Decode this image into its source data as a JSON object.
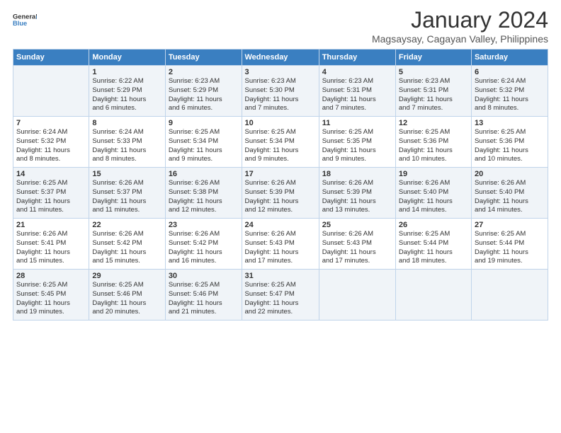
{
  "logo": {
    "general": "General",
    "blue": "Blue"
  },
  "header": {
    "month": "January 2024",
    "subtitle": "Magsaysay, Cagayan Valley, Philippines"
  },
  "weekdays": [
    "Sunday",
    "Monday",
    "Tuesday",
    "Wednesday",
    "Thursday",
    "Friday",
    "Saturday"
  ],
  "weeks": [
    [
      {
        "day": "",
        "detail": ""
      },
      {
        "day": "1",
        "detail": "Sunrise: 6:22 AM\nSunset: 5:29 PM\nDaylight: 11 hours\nand 6 minutes."
      },
      {
        "day": "2",
        "detail": "Sunrise: 6:23 AM\nSunset: 5:29 PM\nDaylight: 11 hours\nand 6 minutes."
      },
      {
        "day": "3",
        "detail": "Sunrise: 6:23 AM\nSunset: 5:30 PM\nDaylight: 11 hours\nand 7 minutes."
      },
      {
        "day": "4",
        "detail": "Sunrise: 6:23 AM\nSunset: 5:31 PM\nDaylight: 11 hours\nand 7 minutes."
      },
      {
        "day": "5",
        "detail": "Sunrise: 6:23 AM\nSunset: 5:31 PM\nDaylight: 11 hours\nand 7 minutes."
      },
      {
        "day": "6",
        "detail": "Sunrise: 6:24 AM\nSunset: 5:32 PM\nDaylight: 11 hours\nand 8 minutes."
      }
    ],
    [
      {
        "day": "7",
        "detail": "Sunrise: 6:24 AM\nSunset: 5:32 PM\nDaylight: 11 hours\nand 8 minutes."
      },
      {
        "day": "8",
        "detail": "Sunrise: 6:24 AM\nSunset: 5:33 PM\nDaylight: 11 hours\nand 8 minutes."
      },
      {
        "day": "9",
        "detail": "Sunrise: 6:25 AM\nSunset: 5:34 PM\nDaylight: 11 hours\nand 9 minutes."
      },
      {
        "day": "10",
        "detail": "Sunrise: 6:25 AM\nSunset: 5:34 PM\nDaylight: 11 hours\nand 9 minutes."
      },
      {
        "day": "11",
        "detail": "Sunrise: 6:25 AM\nSunset: 5:35 PM\nDaylight: 11 hours\nand 9 minutes."
      },
      {
        "day": "12",
        "detail": "Sunrise: 6:25 AM\nSunset: 5:36 PM\nDaylight: 11 hours\nand 10 minutes."
      },
      {
        "day": "13",
        "detail": "Sunrise: 6:25 AM\nSunset: 5:36 PM\nDaylight: 11 hours\nand 10 minutes."
      }
    ],
    [
      {
        "day": "14",
        "detail": "Sunrise: 6:25 AM\nSunset: 5:37 PM\nDaylight: 11 hours\nand 11 minutes."
      },
      {
        "day": "15",
        "detail": "Sunrise: 6:26 AM\nSunset: 5:37 PM\nDaylight: 11 hours\nand 11 minutes."
      },
      {
        "day": "16",
        "detail": "Sunrise: 6:26 AM\nSunset: 5:38 PM\nDaylight: 11 hours\nand 12 minutes."
      },
      {
        "day": "17",
        "detail": "Sunrise: 6:26 AM\nSunset: 5:39 PM\nDaylight: 11 hours\nand 12 minutes."
      },
      {
        "day": "18",
        "detail": "Sunrise: 6:26 AM\nSunset: 5:39 PM\nDaylight: 11 hours\nand 13 minutes."
      },
      {
        "day": "19",
        "detail": "Sunrise: 6:26 AM\nSunset: 5:40 PM\nDaylight: 11 hours\nand 14 minutes."
      },
      {
        "day": "20",
        "detail": "Sunrise: 6:26 AM\nSunset: 5:40 PM\nDaylight: 11 hours\nand 14 minutes."
      }
    ],
    [
      {
        "day": "21",
        "detail": "Sunrise: 6:26 AM\nSunset: 5:41 PM\nDaylight: 11 hours\nand 15 minutes."
      },
      {
        "day": "22",
        "detail": "Sunrise: 6:26 AM\nSunset: 5:42 PM\nDaylight: 11 hours\nand 15 minutes."
      },
      {
        "day": "23",
        "detail": "Sunrise: 6:26 AM\nSunset: 5:42 PM\nDaylight: 11 hours\nand 16 minutes."
      },
      {
        "day": "24",
        "detail": "Sunrise: 6:26 AM\nSunset: 5:43 PM\nDaylight: 11 hours\nand 17 minutes."
      },
      {
        "day": "25",
        "detail": "Sunrise: 6:26 AM\nSunset: 5:43 PM\nDaylight: 11 hours\nand 17 minutes."
      },
      {
        "day": "26",
        "detail": "Sunrise: 6:25 AM\nSunset: 5:44 PM\nDaylight: 11 hours\nand 18 minutes."
      },
      {
        "day": "27",
        "detail": "Sunrise: 6:25 AM\nSunset: 5:44 PM\nDaylight: 11 hours\nand 19 minutes."
      }
    ],
    [
      {
        "day": "28",
        "detail": "Sunrise: 6:25 AM\nSunset: 5:45 PM\nDaylight: 11 hours\nand 19 minutes."
      },
      {
        "day": "29",
        "detail": "Sunrise: 6:25 AM\nSunset: 5:46 PM\nDaylight: 11 hours\nand 20 minutes."
      },
      {
        "day": "30",
        "detail": "Sunrise: 6:25 AM\nSunset: 5:46 PM\nDaylight: 11 hours\nand 21 minutes."
      },
      {
        "day": "31",
        "detail": "Sunrise: 6:25 AM\nSunset: 5:47 PM\nDaylight: 11 hours\nand 22 minutes."
      },
      {
        "day": "",
        "detail": ""
      },
      {
        "day": "",
        "detail": ""
      },
      {
        "day": "",
        "detail": ""
      }
    ]
  ]
}
